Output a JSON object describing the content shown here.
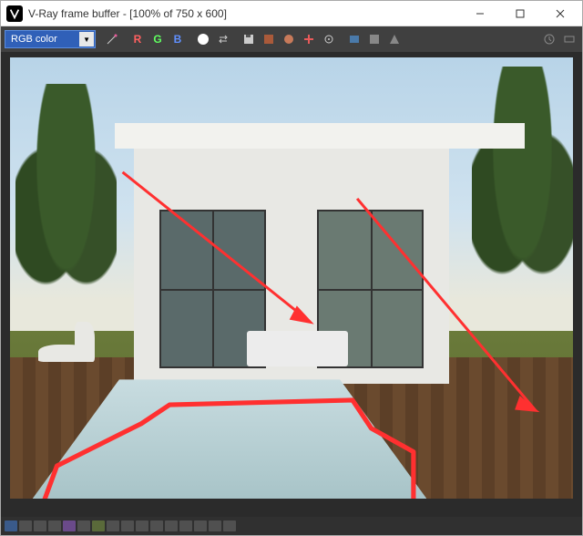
{
  "titlebar": {
    "title": "V-Ray frame buffer - [100% of 750 x 600]"
  },
  "toolbar": {
    "channel_selected": "RGB color",
    "r_label": "R",
    "g_label": "G",
    "b_label": "B"
  },
  "icons": {
    "app": "vray-logo",
    "minimize": "minimize",
    "maximize": "maximize",
    "close": "close"
  }
}
